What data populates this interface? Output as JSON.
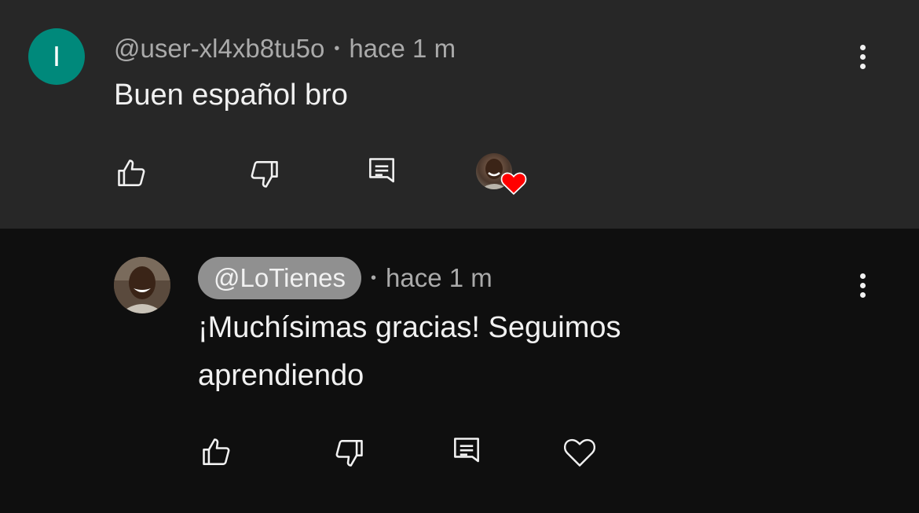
{
  "comment": {
    "avatar_letter": "I",
    "author": "@user-xl4xb8tu5o",
    "separator": "•",
    "time": "hace 1 m",
    "text": "Buen español bro",
    "icons": {
      "like": "thumb-up-icon",
      "dislike": "thumb-down-icon",
      "reply": "reply-icon",
      "more": "more-vert-icon",
      "creator_heart": "creator-heart-icon"
    },
    "colors": {
      "background": "#272727",
      "avatar": "#00897b",
      "heart": "#ff0000"
    }
  },
  "reply": {
    "author": "@LoTienes",
    "separator": "•",
    "time": "hace 1 m",
    "text_line1": "¡Muchísimas gracias! Seguimos",
    "text_line2": "aprendiendo",
    "icons": {
      "like": "thumb-up-icon",
      "dislike": "thumb-down-icon",
      "reply": "reply-icon",
      "heart": "heart-outline-icon",
      "more": "more-vert-icon"
    },
    "colors": {
      "background": "#0f0f0f",
      "handle_chip": "#909090"
    }
  }
}
